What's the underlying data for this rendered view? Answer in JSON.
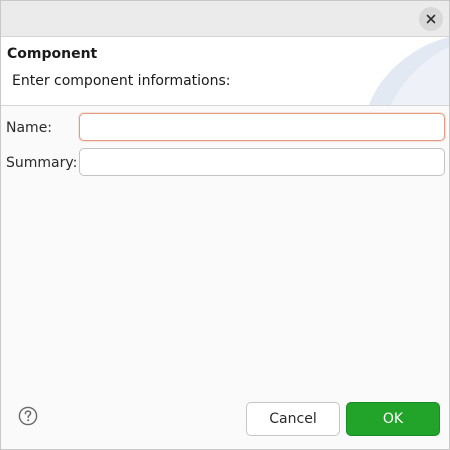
{
  "dialog": {
    "close_icon": "close-icon",
    "title": "Component",
    "description": "Enter component informations:"
  },
  "form": {
    "name_label": "Name:",
    "name_value": "",
    "summary_label": "Summary:",
    "summary_value": ""
  },
  "footer": {
    "help_icon": "help-icon",
    "cancel_label": "Cancel",
    "ok_label": "OK"
  },
  "colors": {
    "ok_button": "#22a32a",
    "focus_border": "#e89a7f",
    "header_art": "#dfe6f2"
  }
}
